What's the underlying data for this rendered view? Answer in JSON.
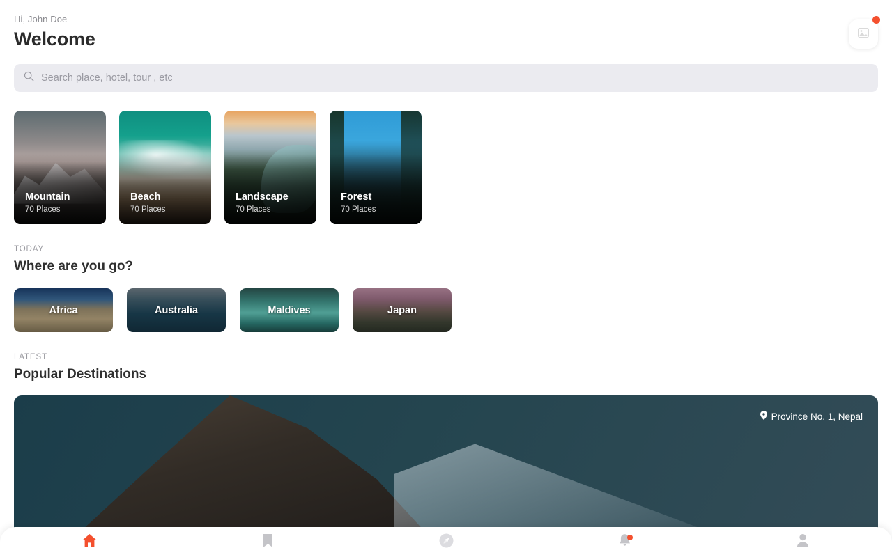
{
  "header": {
    "greeting": "Hi, John Doe",
    "title": "Welcome",
    "avatar_icon": "image-placeholder-icon",
    "avatar_badge_color": "#f4502e"
  },
  "search": {
    "placeholder": "Search place, hotel, tour , etc",
    "value": "",
    "icon": "search-icon"
  },
  "categories": [
    {
      "name": "Mountain",
      "count": "70 Places",
      "photo": "mountain"
    },
    {
      "name": "Beach",
      "count": "70 Places",
      "photo": "beach"
    },
    {
      "name": "Landscape",
      "count": "70 Places",
      "photo": "landscape"
    },
    {
      "name": "Forest",
      "count": "70 Places",
      "photo": "forest"
    }
  ],
  "today_section": {
    "kicker": "TODAY",
    "title": "Where are you go?"
  },
  "destinations": [
    {
      "name": "Africa",
      "photo": "africa"
    },
    {
      "name": "Australia",
      "photo": "australia"
    },
    {
      "name": "Maldives",
      "photo": "maldives"
    },
    {
      "name": "Japan",
      "photo": "japan"
    }
  ],
  "latest_section": {
    "kicker": "LATEST",
    "title": "Popular Destinations"
  },
  "hero": {
    "location": "Province No. 1, Nepal",
    "location_icon": "map-pin-icon"
  },
  "bottom_nav": {
    "items": [
      {
        "icon": "home-icon",
        "active": true,
        "badge": false
      },
      {
        "icon": "bookmark-icon",
        "active": false,
        "badge": false
      },
      {
        "icon": "compass-icon",
        "active": false,
        "badge": false
      },
      {
        "icon": "bell-icon",
        "active": false,
        "badge": true
      },
      {
        "icon": "profile-icon",
        "active": false,
        "badge": false
      }
    ],
    "active_color": "#f4502e",
    "inactive_color": "#c4c4c8",
    "badge_color": "#f4502e"
  }
}
